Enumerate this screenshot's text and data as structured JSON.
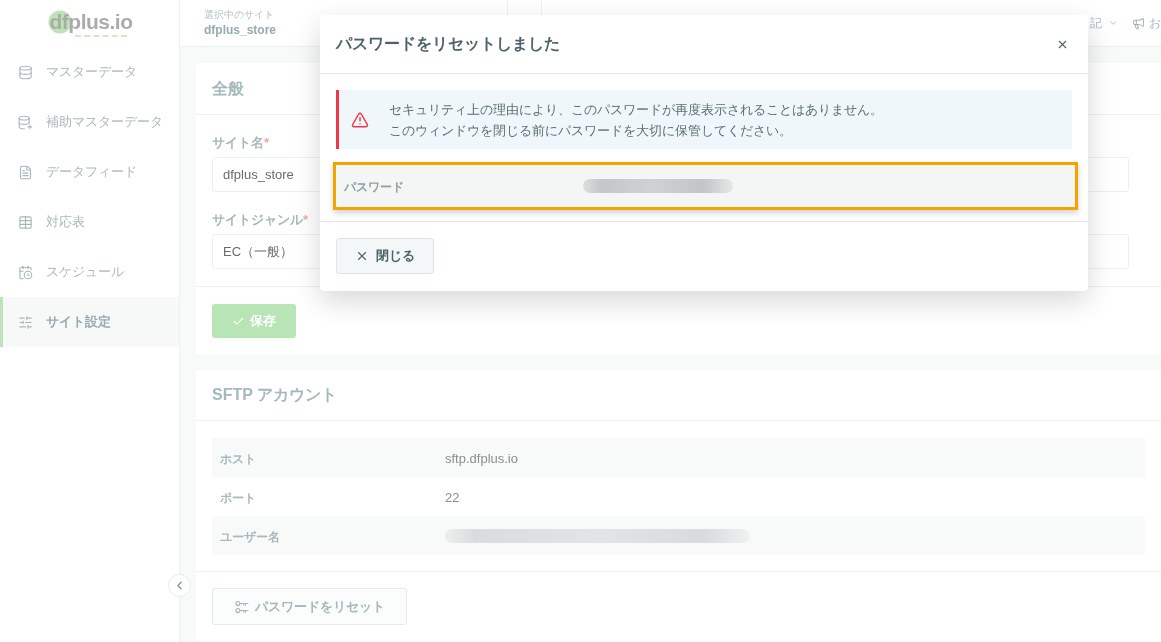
{
  "sidebar": {
    "logo": "dfplus.io",
    "items": [
      {
        "label": "マスターデータ",
        "selected": false
      },
      {
        "label": "補助マスターデータ",
        "selected": false
      },
      {
        "label": "データフィード",
        "selected": false
      },
      {
        "label": "対応表",
        "selected": false
      },
      {
        "label": "スケジュール",
        "selected": false
      },
      {
        "label": "サイト設定",
        "selected": true
      }
    ]
  },
  "header": {
    "site_caption": "選択中のサイト",
    "site_name": "dfplus_store",
    "menu_label": "記",
    "notice_label": "お"
  },
  "general_card": {
    "title": "全般",
    "fields": [
      {
        "label": "サイト名",
        "required_mark": "*",
        "value": "dfplus_store"
      },
      {
        "label": "サイトジャンル",
        "required_mark": "*",
        "value": "EC（一般）"
      }
    ],
    "save_button": "保存"
  },
  "sftp_card": {
    "title": "SFTP アカウント",
    "rows": [
      {
        "label": "ホスト",
        "value": "sftp.dfplus.io",
        "redacted": false
      },
      {
        "label": "ポート",
        "value": "22",
        "redacted": false
      },
      {
        "label": "ユーザー名",
        "redacted": true
      }
    ],
    "reset_button": "パスワードをリセット"
  },
  "modal": {
    "title": "パスワードをリセットしました",
    "alert_lines": [
      "セキュリティ上の理由により、このパスワードが再度表示されることはありません。",
      "このウィンドウを閉じる前にパスワードを大切に保管してください。"
    ],
    "password_row": {
      "label": "パスワード",
      "redacted": true,
      "highlighted": true
    },
    "close_button": "閉じる"
  }
}
